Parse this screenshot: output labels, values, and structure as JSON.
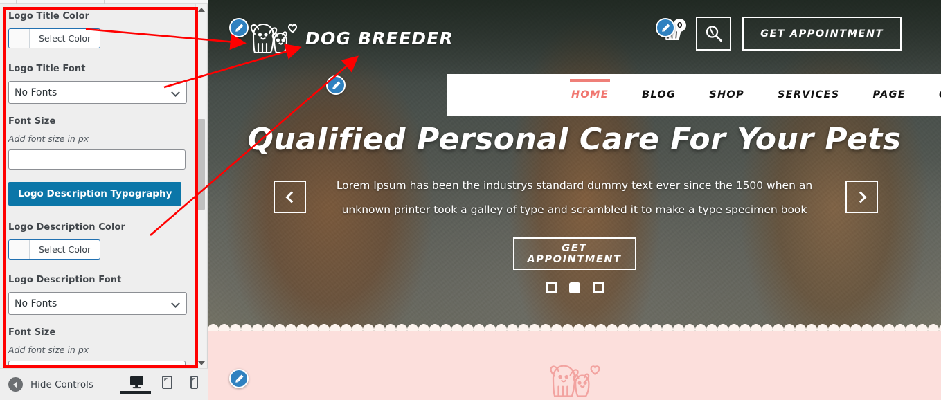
{
  "sidebar": {
    "fields": [
      {
        "label": "Logo Title Color",
        "type": "color",
        "pick_label": "Select Color",
        "swatch": "#ffffff"
      },
      {
        "label": "Logo Title Font",
        "type": "select",
        "value": "No Fonts"
      },
      {
        "label": "Font Size",
        "type": "text",
        "description": "Add font size in px",
        "value": "",
        "placeholder": ""
      },
      {
        "label": "Logo Description Typography",
        "type": "button",
        "color": "#0b76a8"
      },
      {
        "label": "Logo Description Color",
        "type": "color",
        "pick_label": "Select Color",
        "swatch": "#ffffff"
      },
      {
        "label": "Logo Description Font",
        "type": "select",
        "value": "No Fonts"
      },
      {
        "label": "Font Size",
        "type": "text",
        "description": "Add font size in px",
        "value": "",
        "placeholder": ""
      }
    ],
    "footer": {
      "hide_controls_label": "Hide Controls",
      "devices": [
        {
          "name": "desktop",
          "active": true
        },
        {
          "name": "tablet",
          "active": false
        },
        {
          "name": "mobile",
          "active": false
        }
      ]
    }
  },
  "preview": {
    "header": {
      "logo_title": "DOG BREEDER",
      "cart_count": "0",
      "appointment_label": "GET APPOINTMENT",
      "icons": {
        "cart": "shopping-basket-icon",
        "search": "search-icon"
      }
    },
    "nav": {
      "items": [
        {
          "label": "HOME",
          "active": true
        },
        {
          "label": "BLOG",
          "active": false
        },
        {
          "label": "SHOP",
          "active": false
        },
        {
          "label": "SERVICES",
          "active": false
        },
        {
          "label": "PAGE",
          "active": false
        },
        {
          "label": "CONTACT",
          "active": false
        }
      ],
      "active_color": "#ef7f78"
    },
    "hero": {
      "title": "Qualified Personal Care For Your Pets",
      "subtitle": "Lorem Ipsum has been the industrys standard dummy text ever since the 1500 when an unknown printer took a galley of type and scrambled it to make a type specimen book",
      "cta_label": "GET APPOINTMENT",
      "prev_label": "‹",
      "next_label": "›",
      "slides": [
        {
          "active": false
        },
        {
          "active": true
        },
        {
          "active": false
        }
      ]
    },
    "pink_section": {
      "background": "#fcdfdc",
      "illustration": "dog-cat-heart-illustration"
    }
  },
  "annotations": {
    "box_color": "#ff0000",
    "arrows": [
      {
        "from": "select-color-field",
        "to": "logo-mark"
      },
      {
        "from": "logo-title-font-select",
        "to": "logo-mark-lower"
      },
      {
        "from": "logo-description-color-field",
        "to": "nav-home-item"
      }
    ]
  }
}
